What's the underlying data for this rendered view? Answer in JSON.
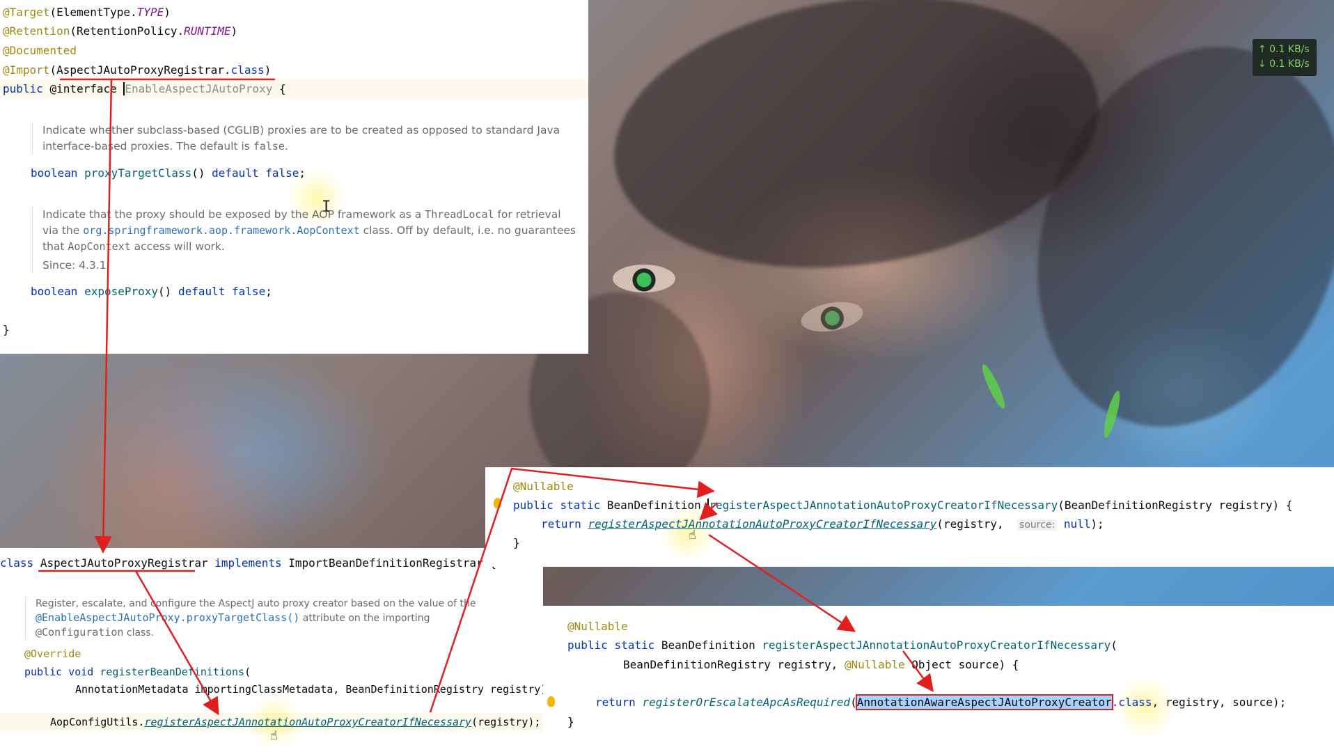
{
  "network_monitor": {
    "upload": "↑ 0.1 KB/s",
    "download": "↓ 0.1 KB/s"
  },
  "panel_interface": {
    "lines": [
      {
        "ann": "@Target",
        "rest_open": "(ElementType.",
        "italic": "TYPE",
        "rest_close": ")"
      },
      {
        "ann": "@Retention",
        "rest_open": "(RetentionPolicy.",
        "italic": "RUNTIME",
        "rest_close": ")"
      },
      {
        "ann": "@Documented"
      },
      {
        "ann": "@Import",
        "open": "(",
        "cls": "AspectJAutoProxyRegistrar",
        "dot": ".",
        "kw": "class",
        "close": ")"
      }
    ],
    "decl": {
      "kw1": "public",
      "kw2": "@interface",
      "name": "EnableAspectJAutoProxy",
      "brace": "{"
    },
    "doc1_a": "Indicate whether subclass-based (CGLIB) proxies are to be created as opposed to standard Java interface-based proxies. The default is ",
    "doc1_code": "false",
    "doc1_b": ".",
    "method1": {
      "type": "boolean",
      "name": "proxyTargetClass",
      "rest": "() ",
      "kw": "default",
      "val": "false",
      "end": ";"
    },
    "doc2_a": "Indicate that the proxy should be exposed by the AOP framework as a ",
    "doc2_code1": "ThreadLocal",
    "doc2_b": " for retrieval via the ",
    "doc2_link": "org.springframework.aop.framework.AopContext",
    "doc2_c": " class. Off by default, i.e. no guarantees that ",
    "doc2_code2": "AopContext",
    "doc2_d": " access will work.",
    "doc2_since": "Since: 4.3.1",
    "method2": {
      "type": "boolean",
      "name": "exposeProxy",
      "rest": "() ",
      "kw": "default",
      "val": "false",
      "end": ";"
    },
    "close": "}"
  },
  "panel_registrar": {
    "decl": {
      "kw": "class",
      "name": "AspectJAutoProxyRegistrar",
      "kw2": "implements",
      "iface": "ImportBeanDefinitionRegistrar",
      "brace": "{"
    },
    "doc_a": "Register, escalate, and configure the AspectJ auto proxy creator based on the value of the ",
    "doc_link": "@EnableAspectJAutoProxy.proxyTargetClass()",
    "doc_b": " attribute on the importing ",
    "doc_code": "@Configuration",
    "doc_c": " class.",
    "override": "@Override",
    "method": {
      "kw1": "public",
      "kw2": "void",
      "name": "registerBeanDefinitions",
      "open": "("
    },
    "params": "AnnotationMetadata importingClassMetadata, BeanDefinitionRegistry registry)",
    "call": {
      "obj": "AopConfigUtils.",
      "fn": "registerAspectJAnnotationAutoProxyCreatorIfNecessary",
      "args": "(registry);"
    }
  },
  "panel_utils1": {
    "ann": "@Nullable",
    "decl": {
      "kw1": "public",
      "kw2": "static",
      "type": "BeanDefinition",
      "name": "registerAspectJAnnotationAutoProxyCreatorIfNecessary",
      "params": "(BeanDefinitionRegistry registry) {"
    },
    "ret": {
      "kw": "return",
      "fn": "registerAspectJAnnotationAutoProxyCreatorIfNecessary",
      "a1": "(registry, ",
      "hint": "source:",
      "val": "null",
      "end": ");"
    },
    "close": "}"
  },
  "panel_utils2": {
    "ann": "@Nullable",
    "decl": {
      "kw1": "public",
      "kw2": "static",
      "type": "BeanDefinition",
      "name": "registerAspectJAnnotationAutoProxyCreatorIfNecessary",
      "open": "("
    },
    "params_a": "BeanDefinitionRegistry registry, ",
    "params_ann": "@Nullable",
    "params_b": " Object source) {",
    "ret": {
      "kw": "return",
      "fn": "registerOrEscalateApcAsRequired",
      "open": "(",
      "cls": "AnnotationAwareAspectJAutoProxyCreator",
      "kw2": ".class",
      "rest": ", registry, source);"
    },
    "close": "}"
  },
  "colors": {
    "annotation": "#9e880d",
    "keyword": "#0033b3",
    "method": "#00627a",
    "arrow": "#e02020",
    "selection": "#a6d2ff"
  }
}
